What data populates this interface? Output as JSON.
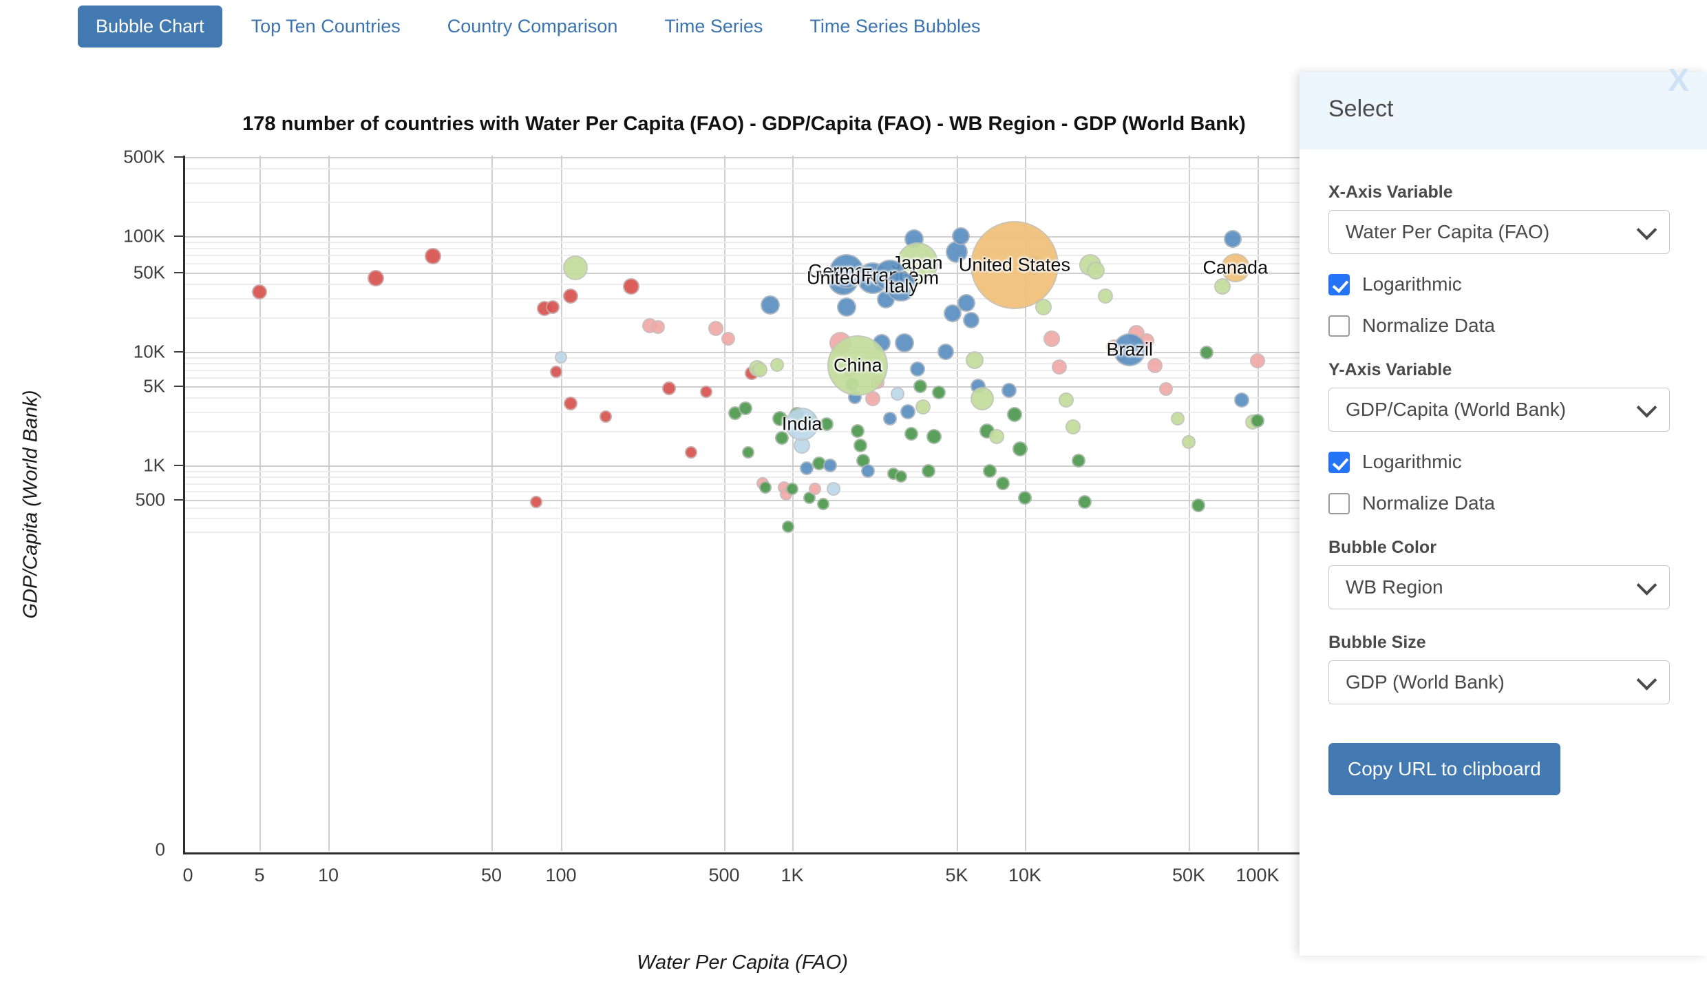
{
  "tabs": [
    {
      "label": "Bubble Chart",
      "active": true
    },
    {
      "label": "Top Ten Countries",
      "active": false
    },
    {
      "label": "Country Comparison",
      "active": false
    },
    {
      "label": "Time Series",
      "active": false
    },
    {
      "label": "Time Series Bubbles",
      "active": false
    }
  ],
  "panel": {
    "title": "Select",
    "close_label": "X",
    "x_axis_label": "X-Axis Variable",
    "x_axis_value": "Water Per Capita (FAO)",
    "x_log_label": "Logarithmic",
    "x_log_checked": true,
    "x_norm_label": "Normalize Data",
    "x_norm_checked": false,
    "y_axis_label": "Y-Axis Variable",
    "y_axis_value": "GDP/Capita (World Bank)",
    "y_log_label": "Logarithmic",
    "y_log_checked": true,
    "y_norm_label": "Normalize Data",
    "y_norm_checked": false,
    "bubble_color_label": "Bubble Color",
    "bubble_color_value": "WB Region",
    "bubble_size_label": "Bubble Size",
    "bubble_size_value": "GDP (World Bank)",
    "copy_button": "Copy URL to clipboard"
  },
  "chart_data": {
    "type": "scatter",
    "title": "178 number of countries with Water Per Capita (FAO) - GDP/Capita (FAO) - WB Region - GDP (World Bank)",
    "xlabel": "Water Per Capita (FAO)",
    "ylabel": "GDP/Capita (World Bank)",
    "xscale": "log",
    "yscale": "log",
    "grid": true,
    "legend": "none",
    "country_count": 178,
    "xticks": [
      "0",
      "5",
      "10",
      "50",
      "100",
      "500",
      "1K",
      "5K",
      "10K",
      "50K",
      "100K"
    ],
    "yticks": [
      "500K",
      "100K",
      "50K",
      "10K",
      "5K",
      "1K",
      "500",
      "0"
    ],
    "color_palette": {
      "red": "#d9534f",
      "blue": "#5b8fc0",
      "green": "#4e9a4e",
      "light_green": "#c3dd9c",
      "pink": "#f0a9a7",
      "light_blue": "#bcd8ea",
      "orange": "#f0c078"
    },
    "labeled_points": [
      {
        "name": "United States",
        "x": 9000,
        "y": 58000,
        "color": "orange",
        "r": 64
      },
      {
        "name": "China",
        "x": 1900,
        "y": 7600,
        "color": "light_green",
        "r": 44
      },
      {
        "name": "Japan",
        "x": 3400,
        "y": 60000,
        "color": "light_green",
        "r": 30
      },
      {
        "name": "Germany",
        "x": 1700,
        "y": 51000,
        "color": "blue",
        "r": 25
      },
      {
        "name": "United Kingdom",
        "x": 2200,
        "y": 45000,
        "color": "blue",
        "r": 23
      },
      {
        "name": "France",
        "x": 2600,
        "y": 47000,
        "color": "blue",
        "r": 23
      },
      {
        "name": "Italy",
        "x": 2900,
        "y": 38000,
        "color": "blue",
        "r": 22
      },
      {
        "name": "Brazil",
        "x": 28000,
        "y": 10500,
        "color": "blue",
        "r": 24
      },
      {
        "name": "India",
        "x": 1100,
        "y": 2300,
        "color": "light_blue",
        "r": 24
      },
      {
        "name": "Canada",
        "x": 80000,
        "y": 55000,
        "color": "orange",
        "r": 21
      }
    ],
    "points": [
      {
        "x": 5,
        "y": 34000,
        "c": "red",
        "r": 11
      },
      {
        "x": 16,
        "y": 45000,
        "c": "red",
        "r": 12
      },
      {
        "x": 28,
        "y": 68000,
        "c": "red",
        "r": 12
      },
      {
        "x": 85,
        "y": 24000,
        "c": "red",
        "r": 11
      },
      {
        "x": 92,
        "y": 25000,
        "c": "red",
        "r": 10
      },
      {
        "x": 78,
        "y": 470,
        "c": "red",
        "r": 9
      },
      {
        "x": 110,
        "y": 31000,
        "c": "red",
        "r": 11
      },
      {
        "x": 115,
        "y": 55000,
        "c": "light_green",
        "r": 18
      },
      {
        "x": 100,
        "y": 9000,
        "c": "light_blue",
        "r": 9
      },
      {
        "x": 95,
        "y": 6700,
        "c": "red",
        "r": 9
      },
      {
        "x": 110,
        "y": 3500,
        "c": "red",
        "r": 10
      },
      {
        "x": 155,
        "y": 2700,
        "c": "red",
        "r": 9
      },
      {
        "x": 200,
        "y": 38000,
        "c": "red",
        "r": 12
      },
      {
        "x": 240,
        "y": 17000,
        "c": "pink",
        "r": 11
      },
      {
        "x": 260,
        "y": 16500,
        "c": "pink",
        "r": 10
      },
      {
        "x": 290,
        "y": 4800,
        "c": "red",
        "r": 10
      },
      {
        "x": 360,
        "y": 1300,
        "c": "red",
        "r": 9
      },
      {
        "x": 420,
        "y": 4500,
        "c": "red",
        "r": 9
      },
      {
        "x": 460,
        "y": 16000,
        "c": "pink",
        "r": 11
      },
      {
        "x": 520,
        "y": 13000,
        "c": "pink",
        "r": 10
      },
      {
        "x": 560,
        "y": 2900,
        "c": "green",
        "r": 10
      },
      {
        "x": 620,
        "y": 3200,
        "c": "green",
        "r": 10
      },
      {
        "x": 640,
        "y": 1300,
        "c": "green",
        "r": 9
      },
      {
        "x": 660,
        "y": 6500,
        "c": "red",
        "r": 10
      },
      {
        "x": 700,
        "y": 7200,
        "c": "light_green",
        "r": 12
      },
      {
        "x": 720,
        "y": 7000,
        "c": "light_green",
        "r": 11
      },
      {
        "x": 740,
        "y": 700,
        "c": "pink",
        "r": 9
      },
      {
        "x": 760,
        "y": 640,
        "c": "green",
        "r": 9
      },
      {
        "x": 800,
        "y": 26000,
        "c": "blue",
        "r": 14
      },
      {
        "x": 860,
        "y": 7700,
        "c": "light_green",
        "r": 10
      },
      {
        "x": 880,
        "y": 2600,
        "c": "green",
        "r": 11
      },
      {
        "x": 900,
        "y": 1750,
        "c": "green",
        "r": 10
      },
      {
        "x": 920,
        "y": 640,
        "c": "pink",
        "r": 9
      },
      {
        "x": 940,
        "y": 560,
        "c": "pink",
        "r": 9
      },
      {
        "x": 960,
        "y": 230,
        "c": "green",
        "r": 9
      },
      {
        "x": 1000,
        "y": 620,
        "c": "green",
        "r": 9
      },
      {
        "x": 1050,
        "y": 2800,
        "c": "green",
        "r": 11
      },
      {
        "x": 1100,
        "y": 1500,
        "c": "light_blue",
        "r": 12
      },
      {
        "x": 1150,
        "y": 950,
        "c": "blue",
        "r": 10
      },
      {
        "x": 1180,
        "y": 520,
        "c": "green",
        "r": 9
      },
      {
        "x": 1200,
        "y": 2500,
        "c": "green",
        "r": 10
      },
      {
        "x": 1250,
        "y": 620,
        "c": "pink",
        "r": 9
      },
      {
        "x": 1300,
        "y": 1050,
        "c": "green",
        "r": 10
      },
      {
        "x": 1350,
        "y": 440,
        "c": "green",
        "r": 9
      },
      {
        "x": 1400,
        "y": 2300,
        "c": "green",
        "r": 10
      },
      {
        "x": 1450,
        "y": 1000,
        "c": "blue",
        "r": 10
      },
      {
        "x": 1500,
        "y": 620,
        "c": "light_blue",
        "r": 10
      },
      {
        "x": 1600,
        "y": 12000,
        "c": "pink",
        "r": 16
      },
      {
        "x": 1650,
        "y": 43000,
        "c": "blue",
        "r": 22
      },
      {
        "x": 1700,
        "y": 25000,
        "c": "blue",
        "r": 14
      },
      {
        "x": 1750,
        "y": 7000,
        "c": "pink",
        "r": 10
      },
      {
        "x": 1800,
        "y": 5200,
        "c": "green",
        "r": 10
      },
      {
        "x": 1850,
        "y": 4000,
        "c": "blue",
        "r": 10
      },
      {
        "x": 1900,
        "y": 2000,
        "c": "green",
        "r": 10
      },
      {
        "x": 1950,
        "y": 1500,
        "c": "green",
        "r": 10
      },
      {
        "x": 2000,
        "y": 1100,
        "c": "green",
        "r": 10
      },
      {
        "x": 2100,
        "y": 900,
        "c": "blue",
        "r": 10
      },
      {
        "x": 2200,
        "y": 3900,
        "c": "pink",
        "r": 11
      },
      {
        "x": 2300,
        "y": 5400,
        "c": "pink",
        "r": 10
      },
      {
        "x": 2400,
        "y": 12000,
        "c": "blue",
        "r": 13
      },
      {
        "x": 2500,
        "y": 29000,
        "c": "blue",
        "r": 13
      },
      {
        "x": 2600,
        "y": 2600,
        "c": "blue",
        "r": 10
      },
      {
        "x": 2700,
        "y": 850,
        "c": "green",
        "r": 9
      },
      {
        "x": 2800,
        "y": 4300,
        "c": "light_blue",
        "r": 10
      },
      {
        "x": 2900,
        "y": 800,
        "c": "green",
        "r": 9
      },
      {
        "x": 3000,
        "y": 12000,
        "c": "blue",
        "r": 14
      },
      {
        "x": 3100,
        "y": 3000,
        "c": "blue",
        "r": 11
      },
      {
        "x": 3200,
        "y": 1900,
        "c": "green",
        "r": 10
      },
      {
        "x": 3300,
        "y": 95000,
        "c": "blue",
        "r": 14
      },
      {
        "x": 3400,
        "y": 7100,
        "c": "blue",
        "r": 11
      },
      {
        "x": 3500,
        "y": 5000,
        "c": "green",
        "r": 10
      },
      {
        "x": 3600,
        "y": 3300,
        "c": "light_green",
        "r": 11
      },
      {
        "x": 3800,
        "y": 900,
        "c": "green",
        "r": 10
      },
      {
        "x": 4000,
        "y": 1800,
        "c": "green",
        "r": 11
      },
      {
        "x": 4200,
        "y": 4400,
        "c": "green",
        "r": 10
      },
      {
        "x": 4500,
        "y": 10000,
        "c": "blue",
        "r": 12
      },
      {
        "x": 4800,
        "y": 22000,
        "c": "blue",
        "r": 13
      },
      {
        "x": 5000,
        "y": 74000,
        "c": "blue",
        "r": 16
      },
      {
        "x": 5200,
        "y": 100000,
        "c": "blue",
        "r": 13
      },
      {
        "x": 5500,
        "y": 27000,
        "c": "blue",
        "r": 13
      },
      {
        "x": 5800,
        "y": 19000,
        "c": "blue",
        "r": 12
      },
      {
        "x": 6000,
        "y": 8500,
        "c": "light_green",
        "r": 13
      },
      {
        "x": 6200,
        "y": 5000,
        "c": "blue",
        "r": 11
      },
      {
        "x": 6500,
        "y": 3900,
        "c": "light_green",
        "r": 17
      },
      {
        "x": 6800,
        "y": 2000,
        "c": "green",
        "r": 11
      },
      {
        "x": 7000,
        "y": 900,
        "c": "green",
        "r": 10
      },
      {
        "x": 7500,
        "y": 1800,
        "c": "light_green",
        "r": 11
      },
      {
        "x": 8000,
        "y": 700,
        "c": "green",
        "r": 10
      },
      {
        "x": 8500,
        "y": 4600,
        "c": "blue",
        "r": 11
      },
      {
        "x": 9000,
        "y": 2800,
        "c": "green",
        "r": 11
      },
      {
        "x": 9500,
        "y": 1400,
        "c": "green",
        "r": 11
      },
      {
        "x": 10000,
        "y": 520,
        "c": "green",
        "r": 10
      },
      {
        "x": 11000,
        "y": 58000,
        "c": "blue",
        "r": 14
      },
      {
        "x": 12000,
        "y": 25000,
        "c": "light_green",
        "r": 12
      },
      {
        "x": 13000,
        "y": 13000,
        "c": "pink",
        "r": 12
      },
      {
        "x": 14000,
        "y": 7400,
        "c": "pink",
        "r": 11
      },
      {
        "x": 15000,
        "y": 3800,
        "c": "light_green",
        "r": 11
      },
      {
        "x": 16000,
        "y": 2200,
        "c": "light_green",
        "r": 11
      },
      {
        "x": 17000,
        "y": 1100,
        "c": "green",
        "r": 10
      },
      {
        "x": 18000,
        "y": 470,
        "c": "green",
        "r": 10
      },
      {
        "x": 19000,
        "y": 58000,
        "c": "light_green",
        "r": 16
      },
      {
        "x": 20000,
        "y": 52000,
        "c": "light_green",
        "r": 13
      },
      {
        "x": 22000,
        "y": 31000,
        "c": "light_green",
        "r": 11
      },
      {
        "x": 24000,
        "y": 11000,
        "c": "pink",
        "r": 11
      },
      {
        "x": 26000,
        "y": 9500,
        "c": "pink",
        "r": 10
      },
      {
        "x": 30000,
        "y": 14500,
        "c": "pink",
        "r": 12
      },
      {
        "x": 33000,
        "y": 12500,
        "c": "pink",
        "r": 11
      },
      {
        "x": 36000,
        "y": 7600,
        "c": "pink",
        "r": 11
      },
      {
        "x": 40000,
        "y": 4700,
        "c": "pink",
        "r": 10
      },
      {
        "x": 45000,
        "y": 2600,
        "c": "light_green",
        "r": 10
      },
      {
        "x": 50000,
        "y": 1600,
        "c": "light_green",
        "r": 10
      },
      {
        "x": 55000,
        "y": 430,
        "c": "green",
        "r": 10
      },
      {
        "x": 60000,
        "y": 9800,
        "c": "green",
        "r": 10
      },
      {
        "x": 70000,
        "y": 38000,
        "c": "light_green",
        "r": 12
      },
      {
        "x": 78000,
        "y": 95000,
        "c": "blue",
        "r": 13
      },
      {
        "x": 85000,
        "y": 3800,
        "c": "blue",
        "r": 11
      },
      {
        "x": 95000,
        "y": 2400,
        "c": "light_green",
        "r": 11
      },
      {
        "x": 100000,
        "y": 8400,
        "c": "pink",
        "r": 11
      },
      {
        "x": 105000,
        "y": 2500,
        "c": "green",
        "r": 10
      }
    ]
  }
}
